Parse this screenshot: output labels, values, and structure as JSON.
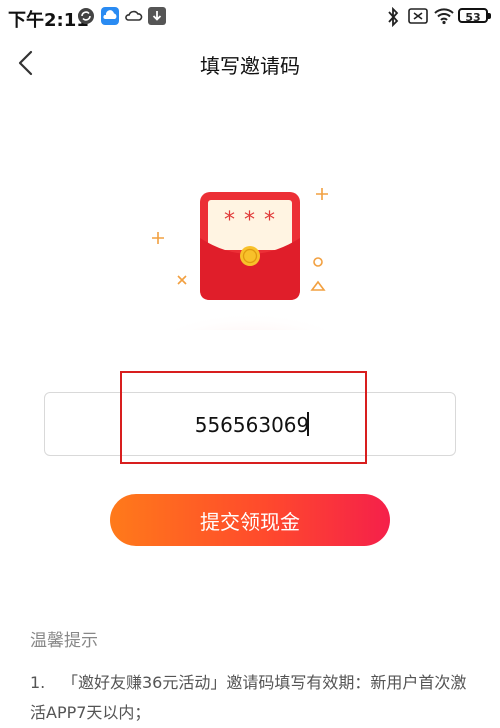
{
  "status_bar": {
    "time": "下午2:11",
    "battery": "53"
  },
  "nav": {
    "title": "填写邀请码"
  },
  "illustration": {
    "card_text": "* * *"
  },
  "invite": {
    "code_value": "556563069"
  },
  "submit": {
    "label": "提交领现金"
  },
  "tips": {
    "title": "温馨提示",
    "items": [
      {
        "num": "1.",
        "text": "「邀好友赚36元活动」邀请码填写有效期：新用户首次激活APP7天以内；"
      }
    ]
  },
  "colors": {
    "accent_start": "#ff7a1a",
    "accent_end": "#f5204a",
    "highlight": "#d81e1e"
  }
}
